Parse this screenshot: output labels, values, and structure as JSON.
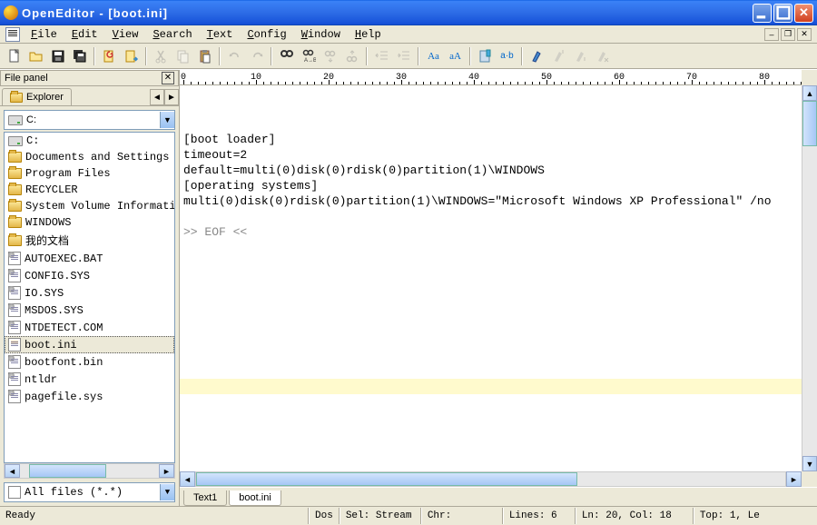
{
  "title": "OpenEditor - [boot.ini]",
  "menu": [
    "File",
    "Edit",
    "View",
    "Search",
    "Text",
    "Config",
    "Window",
    "Help"
  ],
  "file_panel": {
    "title": "File panel",
    "tab": "Explorer",
    "drive": "C:",
    "items": [
      {
        "type": "drive",
        "name": "C:"
      },
      {
        "type": "folder",
        "name": "Documents and Settings"
      },
      {
        "type": "folder",
        "name": "Program Files"
      },
      {
        "type": "folder",
        "name": "RECYCLER"
      },
      {
        "type": "folder",
        "name": "System Volume Information"
      },
      {
        "type": "folder",
        "name": "WINDOWS"
      },
      {
        "type": "folder",
        "name": "我的文档"
      },
      {
        "type": "file",
        "name": "AUTOEXEC.BAT",
        "icon": "sys"
      },
      {
        "type": "file",
        "name": "CONFIG.SYS",
        "icon": "sys"
      },
      {
        "type": "file",
        "name": "IO.SYS",
        "icon": "sys"
      },
      {
        "type": "file",
        "name": "MSDOS.SYS",
        "icon": "sys"
      },
      {
        "type": "file",
        "name": "NTDETECT.COM",
        "icon": "sys"
      },
      {
        "type": "file",
        "name": "boot.ini",
        "icon": "ini",
        "selected": true
      },
      {
        "type": "file",
        "name": "bootfont.bin",
        "icon": "sys"
      },
      {
        "type": "file",
        "name": "ntldr",
        "icon": "sys"
      },
      {
        "type": "file",
        "name": "pagefile.sys",
        "icon": "sys"
      }
    ],
    "filter": "All files (*.*)"
  },
  "editor": {
    "lines": [
      "[boot loader]",
      "timeout=2",
      "default=multi(0)disk(0)rdisk(0)partition(1)\\WINDOWS",
      "[operating systems]",
      "multi(0)disk(0)rdisk(0)partition(1)\\WINDOWS=\"Microsoft Windows XP Professional\" /no"
    ],
    "eof": ">> EOF <<"
  },
  "tabs": [
    "Text1",
    "boot.ini"
  ],
  "active_tab": 1,
  "status": {
    "ready": "Ready",
    "mode": "Dos",
    "sel": "Sel: Stream",
    "chr": "Chr:",
    "lines": "Lines:   6",
    "pos": "Ln: 20, Col: 18",
    "top": "Top: 1, Le"
  },
  "ruler_ticks": [
    0,
    10,
    20,
    30,
    40,
    50,
    60,
    70,
    80
  ]
}
